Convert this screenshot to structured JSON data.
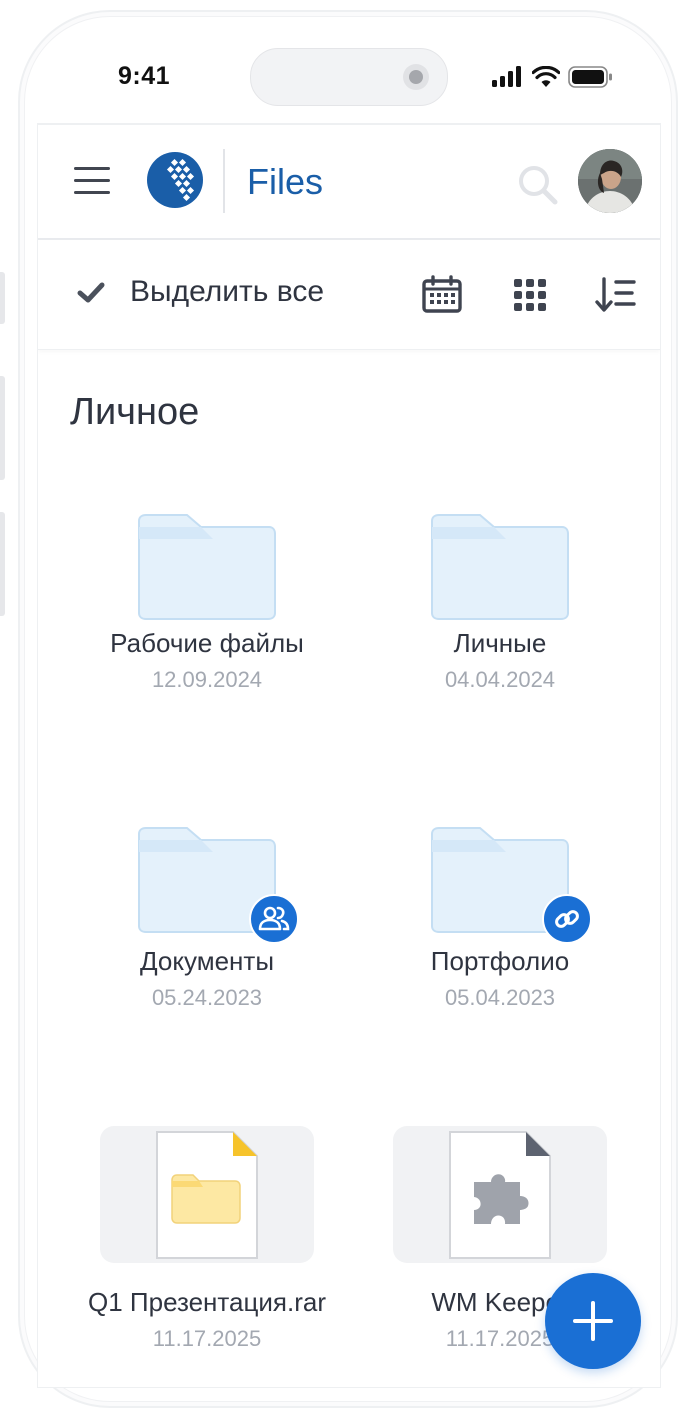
{
  "status_bar": {
    "time": "9:41"
  },
  "header": {
    "title": "Files"
  },
  "toolbar": {
    "select_all_label": "Выделить все"
  },
  "section": {
    "title": "Личное"
  },
  "items": [
    {
      "name": "Рабочие файлы",
      "date": "12.09.2024",
      "type": "folder"
    },
    {
      "name": "Личные",
      "date": "04.04.2024",
      "type": "folder"
    },
    {
      "name": "Документы",
      "date": "05.24.2023",
      "type": "folder-shared"
    },
    {
      "name": "Портфолио",
      "date": "05.04.2023",
      "type": "folder-link"
    },
    {
      "name": "Q1 Презентация.rar",
      "date": "11.17.2025",
      "type": "archive"
    },
    {
      "name": "WM Keeper",
      "date": "11.17.2025",
      "type": "plugin"
    }
  ],
  "colors": {
    "accent": "#1a6fd4",
    "brand": "#1a5ea8",
    "folder": "#e4f1fb",
    "archive_corner": "#f6c32b"
  }
}
